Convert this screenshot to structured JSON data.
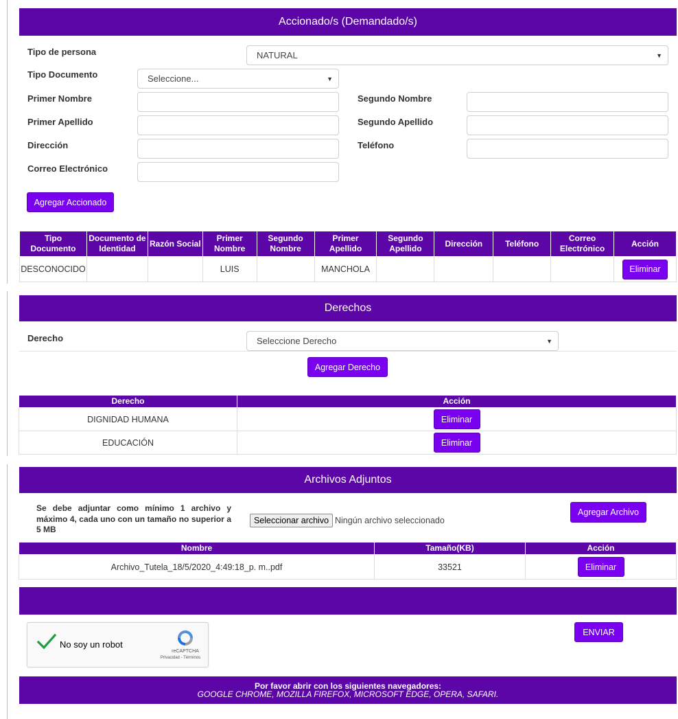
{
  "accionado": {
    "section_title": "Accionado/s (Demandado/s)",
    "tipo_persona_label": "Tipo de persona",
    "tipo_persona_value": "NATURAL",
    "tipo_documento_label": "Tipo Documento",
    "tipo_documento_value": "Seleccione...",
    "primer_nombre_label": "Primer Nombre",
    "segundo_nombre_label": "Segundo Nombre",
    "primer_apellido_label": "Primer Apellido",
    "segundo_apellido_label": "Segundo Apellido",
    "direccion_label": "Dirección",
    "telefono_label": "Teléfono",
    "correo_label": "Correo Electrónico",
    "add_button": "Agregar Accionado",
    "table": {
      "headers": [
        "Tipo Documento",
        "Documento de Identidad",
        "Razón Social",
        "Primer Nombre",
        "Segundo Nombre",
        "Primer Apellido",
        "Segundo Apellido",
        "Dirección",
        "Teléfono",
        "Correo Electrónico",
        "Acción"
      ],
      "rows": [
        [
          "DESCONOCIDO",
          "",
          "",
          "LUIS",
          "",
          "MANCHOLA",
          "",
          "",
          "",
          "",
          "Eliminar"
        ]
      ]
    }
  },
  "derechos": {
    "section_title": "Derechos",
    "derecho_label": "Derecho",
    "derecho_value": "Seleccione Derecho",
    "add_button": "Agregar Derecho",
    "table": {
      "headers": [
        "Derecho",
        "Acción"
      ],
      "rows": [
        [
          "DIGNIDAD HUMANA",
          "Eliminar"
        ],
        [
          "EDUCACIÓN",
          "Eliminar"
        ]
      ]
    }
  },
  "archivos": {
    "section_title": "Archivos Adjuntos",
    "instructions": "Se debe adjuntar como mínimo 1 archivo y máximo 4, cada uno con un tamaño no superior a 5 MB",
    "file_button": "Seleccionar archivo",
    "file_status": "Ningún archivo seleccionado",
    "add_button": "Agregar Archivo",
    "table": {
      "headers": [
        "Nombre",
        "Tamaño(KB)",
        "Acción"
      ],
      "rows": [
        [
          "Archivo_Tutela_18/5/2020_4:49:18_p. m..pdf",
          "33521",
          "Eliminar"
        ]
      ]
    }
  },
  "captcha": {
    "label": "No soy un robot",
    "brand": "reCAPTCHA",
    "links": "Privacidad - Términos"
  },
  "submit_button": "ENVIAR",
  "footer": {
    "line1": "Por favor abrir con los siguientes navegadores:",
    "line2": "GOOGLE CHROME, MOZILLA FIREFOX, MICROSOFT EDGE, OPERA, SAFARI."
  },
  "colors": {
    "primary": "#5c06a8",
    "button": "#7a00f0",
    "check": "#1e9e3e"
  }
}
